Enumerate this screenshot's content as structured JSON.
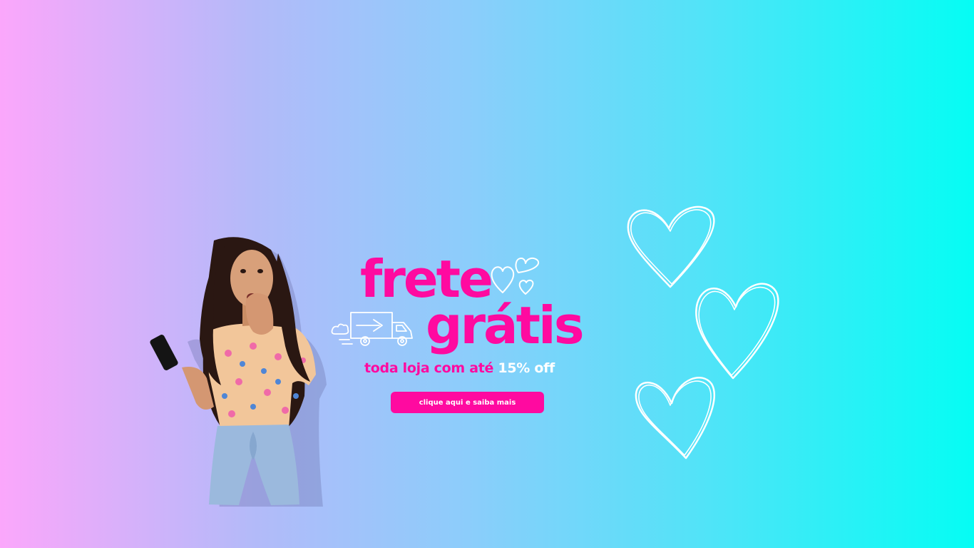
{
  "banner": {
    "headline_line1": "frete",
    "headline_line2": "grátis",
    "subline_prefix": "toda loja com até ",
    "subline_highlight": "15% off",
    "cta_label": "clique aqui e saiba mais"
  },
  "icons": [
    "person-photo",
    "truck-icon",
    "heart-icon"
  ],
  "colors": {
    "accent": "#ff0aa0",
    "gradient_start": "#fba7fb",
    "gradient_end": "#05fdf4",
    "highlight": "#ffffff"
  }
}
